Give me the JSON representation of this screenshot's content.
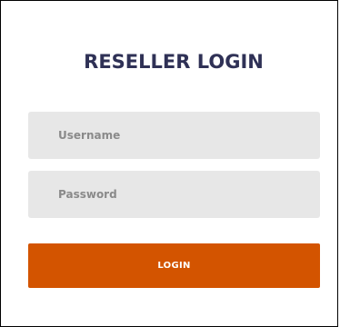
{
  "login_form": {
    "title": "RESELLER LOGIN",
    "username": {
      "placeholder": "Username",
      "value": ""
    },
    "password": {
      "placeholder": "Password",
      "value": ""
    },
    "submit_label": "LOGIN"
  },
  "colors": {
    "title": "#2f3156",
    "field_background": "#e7e7e7",
    "button_background": "#d35400",
    "button_text": "#ffffff"
  }
}
